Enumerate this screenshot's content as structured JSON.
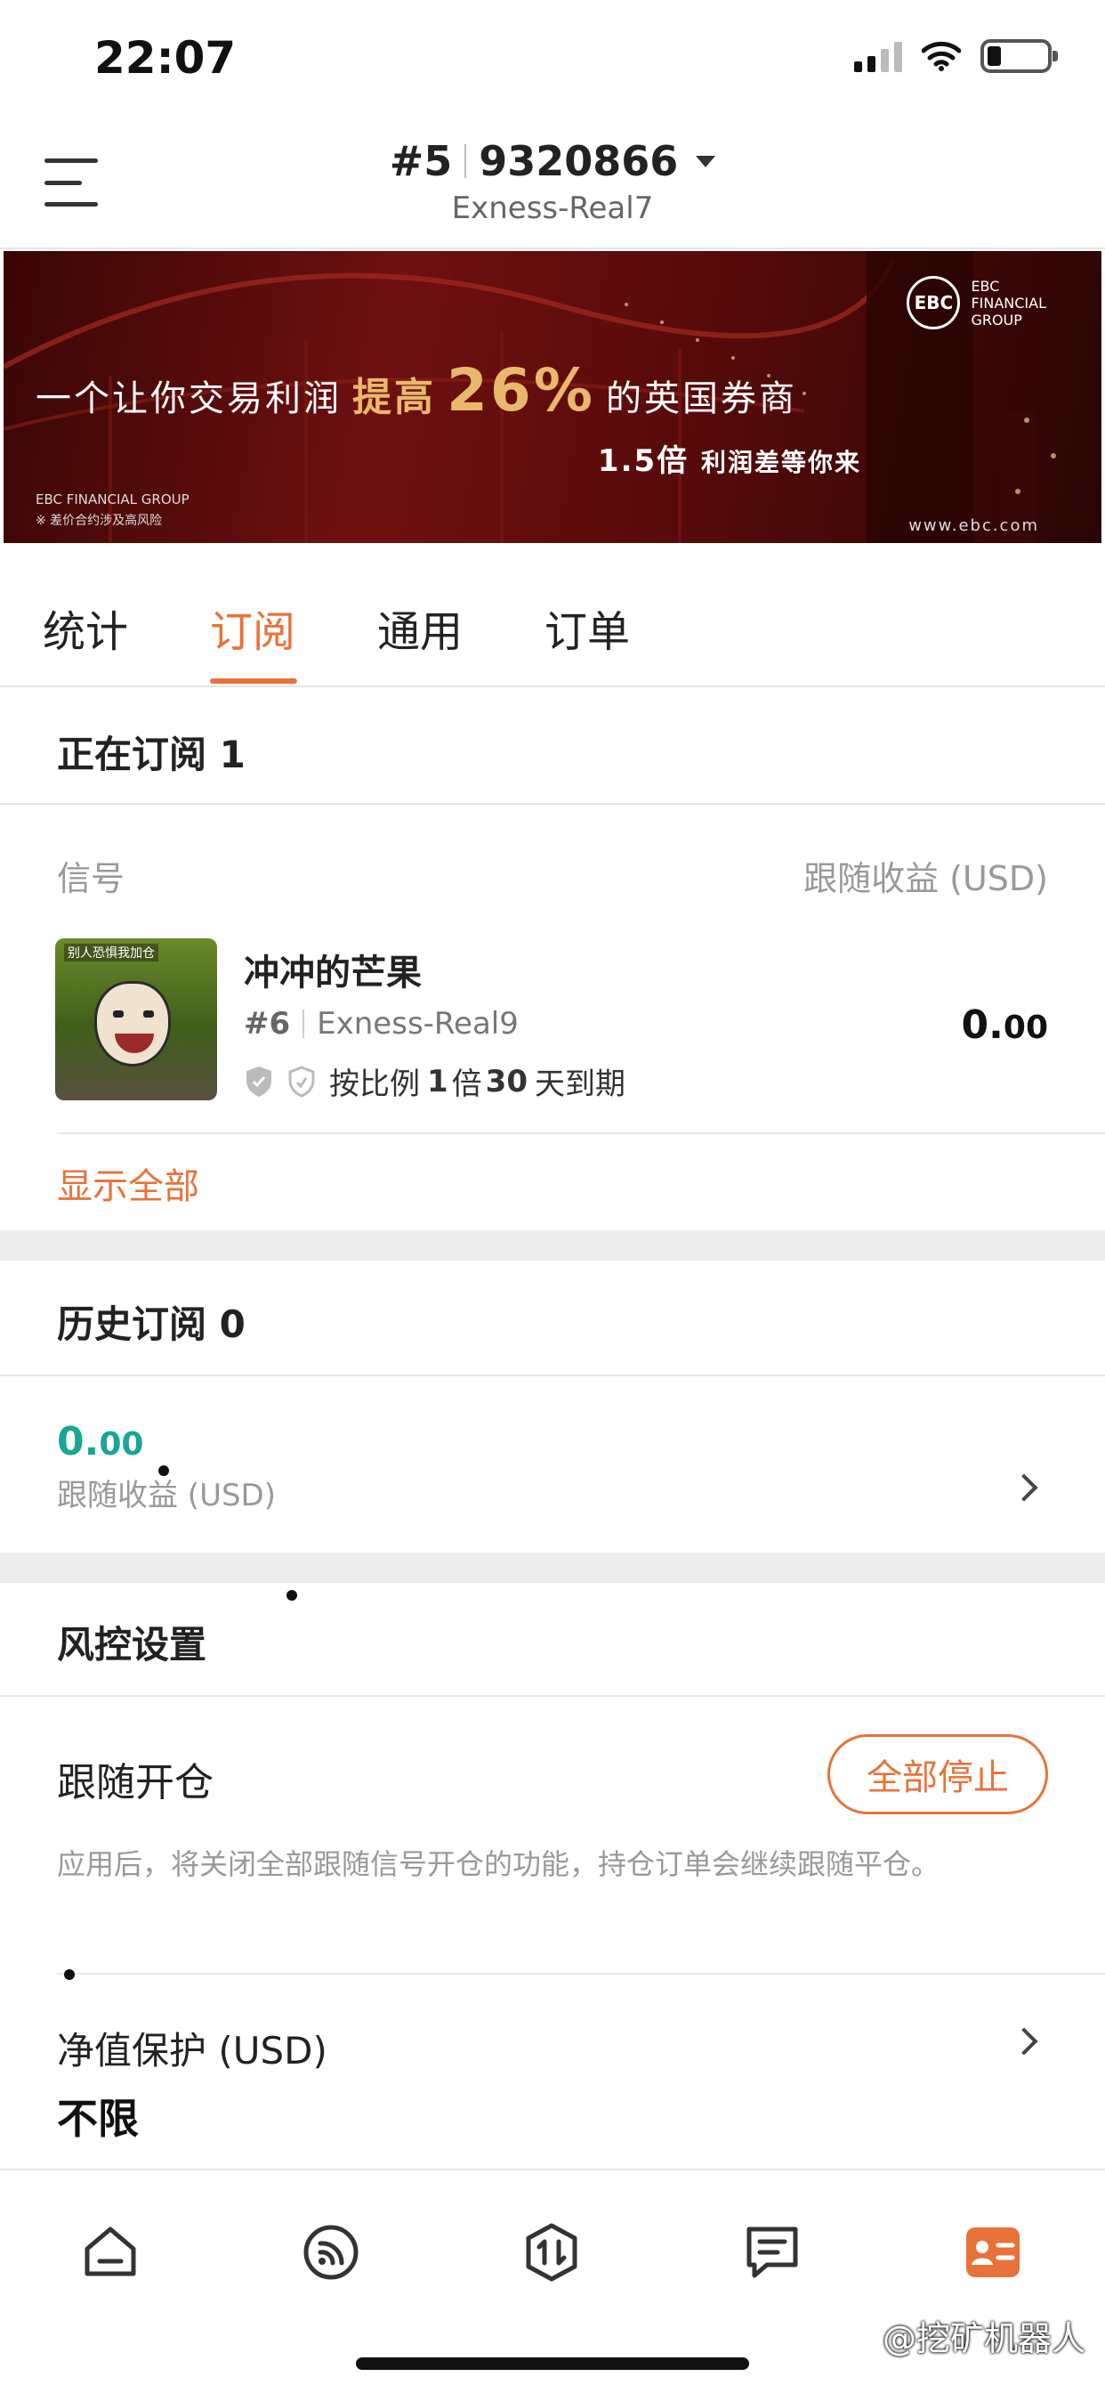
{
  "status_bar": {
    "time": "22:07"
  },
  "header": {
    "account_index": "#5",
    "account_number": "9320866",
    "server": "Exness-Real7"
  },
  "banner": {
    "headline_pre": "一个让你交易利润",
    "headline_mid": "提高",
    "headline_big": "26%",
    "headline_post": "的英国券商",
    "sub_big": "1.5倍",
    "sub_small": "利润差等你来",
    "logo_circle": "EBC",
    "logo_line1": "EBC",
    "logo_line2": "FINANCIAL",
    "logo_line3": "GROUP",
    "footer_line1": "EBC FINANCIAL GROUP",
    "footer_line2": "※ 差价合约涉及高风险",
    "url": "www.ebc.com"
  },
  "tabs": [
    {
      "label": "统计"
    },
    {
      "label": "订阅"
    },
    {
      "label": "通用"
    },
    {
      "label": "订单"
    }
  ],
  "current": {
    "title": "正在订阅 1",
    "col_signal": "信号",
    "col_profit": "跟随收益 (USD)",
    "signal": {
      "avatar_caption": "别人恐惧我加仓",
      "name": "冲冲的芒果",
      "index": "#6",
      "server": "Exness-Real9",
      "ratio_pre": "按比例",
      "ratio_num": "1",
      "ratio_unit": "倍",
      "days_num": "30",
      "days_post": "天到期",
      "value_int": "0.",
      "value_dec": "00"
    },
    "show_all": "显示全部"
  },
  "history": {
    "title": "历史订阅 0",
    "profit_int": "0.",
    "profit_dec": "00",
    "profit_label": "跟随收益 (USD)"
  },
  "risk": {
    "title": "风控设置",
    "follow_open": "跟随开仓",
    "stop_all": "全部停止",
    "follow_desc": "应用后，将关闭全部跟随信号开仓的功能，持仓订单会继续跟随平仓。",
    "equity_label": "净值保护 (USD)",
    "equity_value": "不限"
  },
  "watermark": "@挖矿机器人",
  "colors": {
    "accent": "#e8733a",
    "profit_green": "#1aa594"
  },
  "bottom_nav": [
    {
      "icon": "home-icon"
    },
    {
      "icon": "signal-feed-icon"
    },
    {
      "icon": "trade-icon"
    },
    {
      "icon": "orders-icon"
    },
    {
      "icon": "profile-card-icon"
    }
  ]
}
